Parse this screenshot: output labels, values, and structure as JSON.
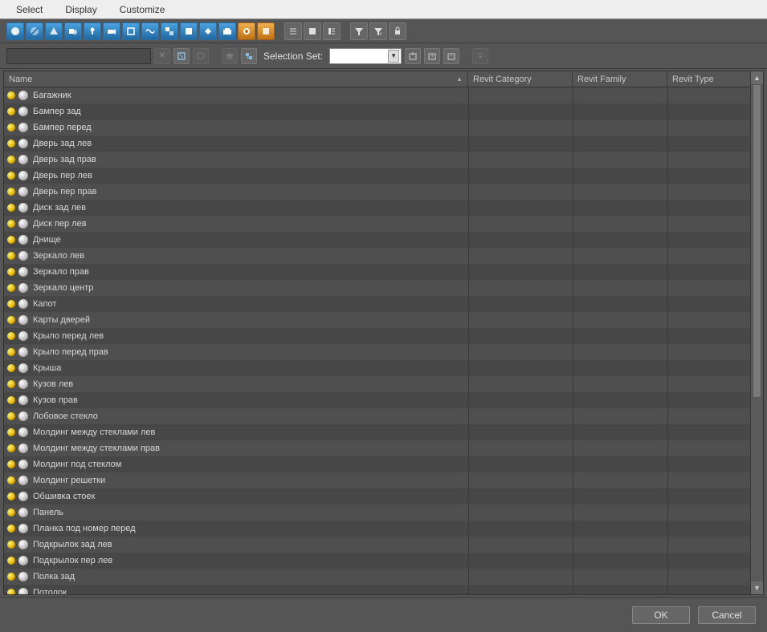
{
  "menu": {
    "select": "Select",
    "display": "Display",
    "customize": "Customize"
  },
  "filter": {
    "input_value": "",
    "selection_set_label": "Selection Set:",
    "selection_set_value": ""
  },
  "columns": {
    "name": "Name",
    "revit_category": "Revit Category",
    "revit_family": "Revit Family",
    "revit_type": "Revit Type"
  },
  "rows": [
    {
      "name": "Багажник"
    },
    {
      "name": "Бампер зад"
    },
    {
      "name": "Бампер перед"
    },
    {
      "name": "Дверь зад лев"
    },
    {
      "name": "Дверь зад прав"
    },
    {
      "name": "Дверь пер лев"
    },
    {
      "name": "Дверь пер прав"
    },
    {
      "name": "Диск зад лев"
    },
    {
      "name": "Диск пер лев"
    },
    {
      "name": "Днище"
    },
    {
      "name": "Зеркало лев"
    },
    {
      "name": "Зеркало прав"
    },
    {
      "name": "Зеркало центр"
    },
    {
      "name": "Капот"
    },
    {
      "name": "Карты дверей"
    },
    {
      "name": "Крыло перед лев"
    },
    {
      "name": "Крыло перед прав"
    },
    {
      "name": "Крыша"
    },
    {
      "name": "Кузов лев"
    },
    {
      "name": "Кузов прав"
    },
    {
      "name": "Лобовое стекло"
    },
    {
      "name": "Молдинг между стеклами лев"
    },
    {
      "name": "Молдинг между стеклами прав"
    },
    {
      "name": "Молдинг под стеклом"
    },
    {
      "name": "Молдинг решетки"
    },
    {
      "name": "Обшивка стоек"
    },
    {
      "name": "Панель"
    },
    {
      "name": "Планка под номер перед"
    },
    {
      "name": "Подкрылок зад лев"
    },
    {
      "name": "Подкрылок пер лев"
    },
    {
      "name": "Полка зад"
    },
    {
      "name": "Потолок"
    }
  ],
  "footer": {
    "ok": "OK",
    "cancel": "Cancel"
  }
}
